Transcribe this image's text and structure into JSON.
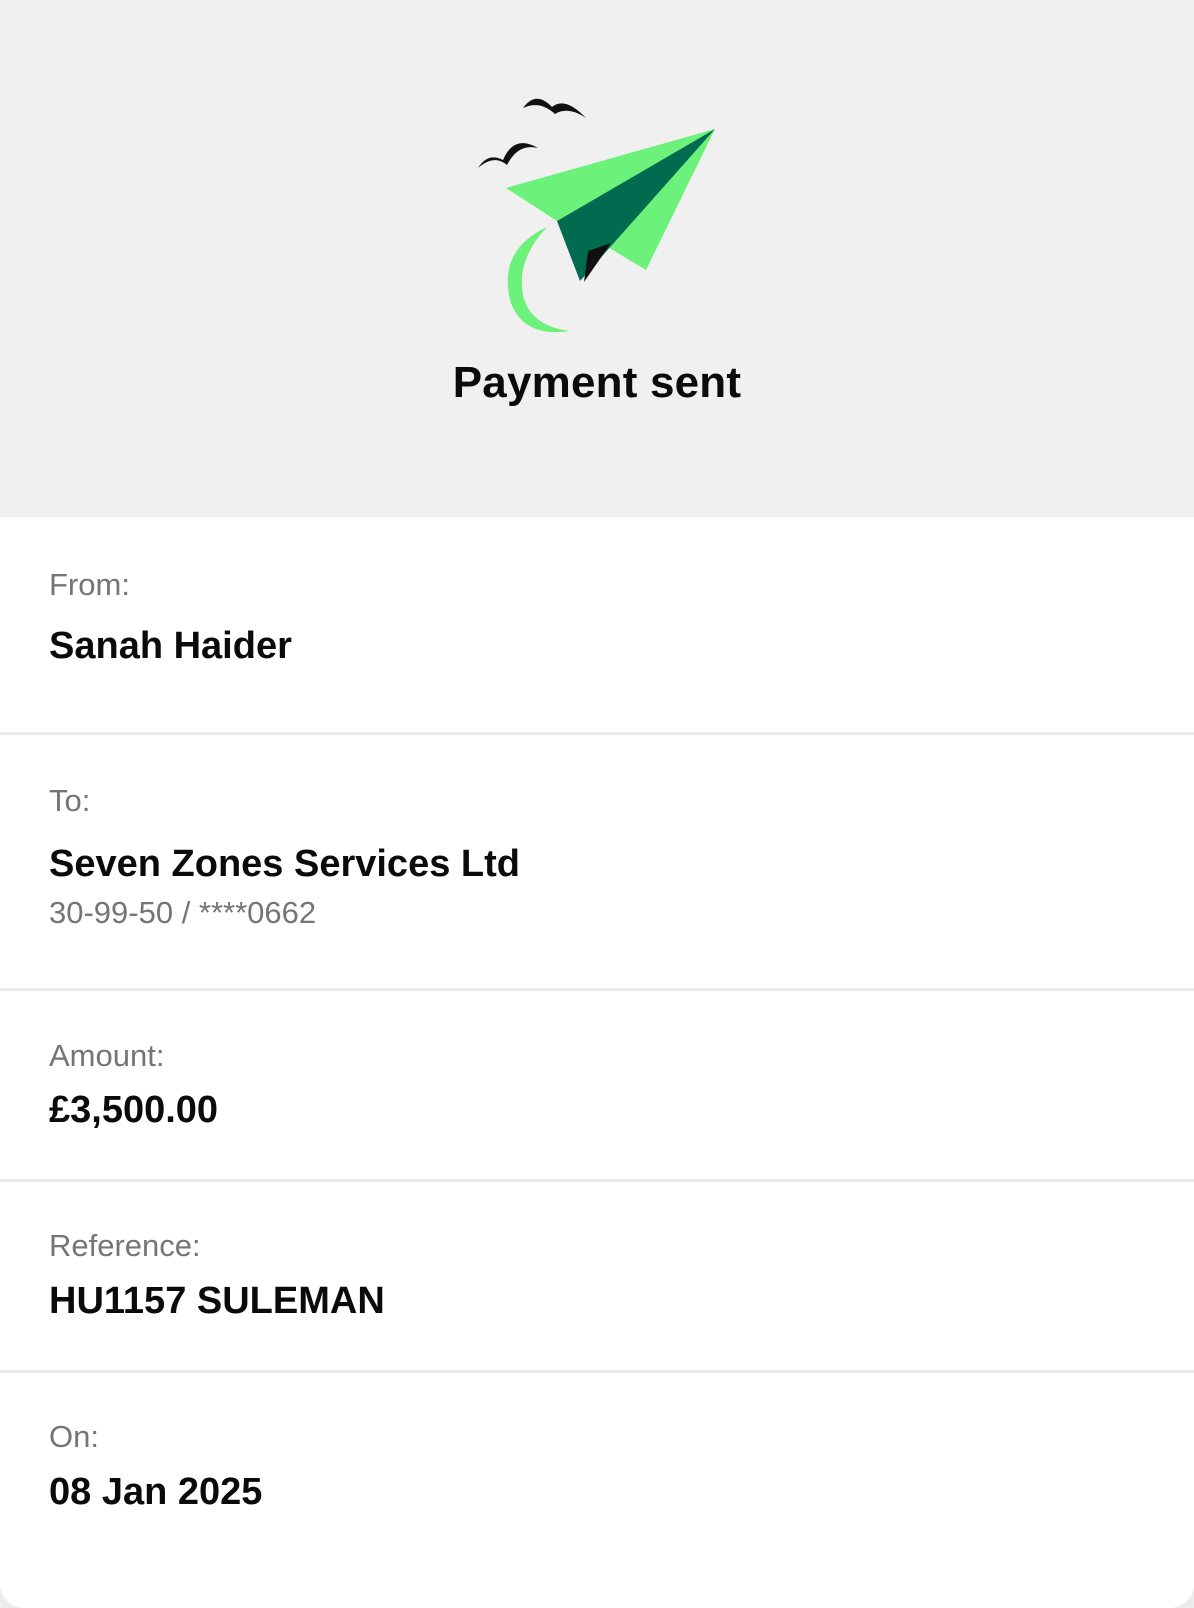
{
  "header": {
    "title": "Payment sent",
    "illustration_icon": "paper-plane-with-birds",
    "colors": {
      "plane_light": "#6cf27a",
      "plane_dark": "#006b4f",
      "background": "#f0f0f0"
    }
  },
  "details": {
    "from": {
      "label": "From:",
      "value": "Sanah Haider"
    },
    "to": {
      "label": "To:",
      "value": "Seven Zones Services Ltd",
      "account": "30-99-50 / ****0662"
    },
    "amount": {
      "label": "Amount:",
      "value": "£3,500.00"
    },
    "reference": {
      "label": "Reference:",
      "value": "HU1157 SULEMAN"
    },
    "on": {
      "label": "On:",
      "value": "08 Jan 2025"
    }
  }
}
